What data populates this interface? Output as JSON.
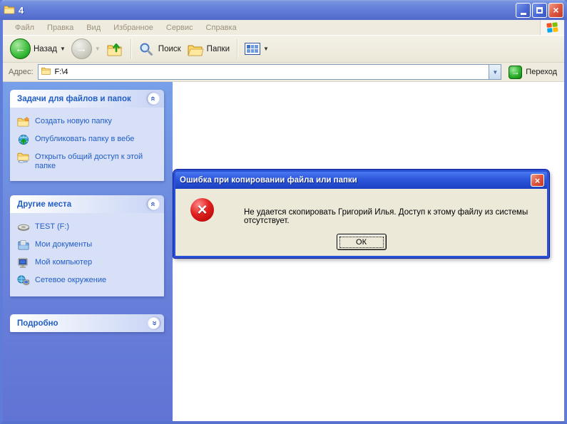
{
  "window": {
    "title": "4",
    "controls": {
      "minimize": "",
      "maximize": "",
      "close": "×"
    }
  },
  "menu": {
    "items": [
      "Файл",
      "Правка",
      "Вид",
      "Избранное",
      "Сервис",
      "Справка"
    ]
  },
  "toolbar": {
    "back_label": "Назад",
    "search_label": "Поиск",
    "folders_label": "Папки"
  },
  "address_bar": {
    "label": "Адрес:",
    "value": "F:\\4",
    "go_label": "Переход"
  },
  "sidebar": {
    "panels": [
      {
        "title": "Задачи для файлов и папок",
        "state": "expanded",
        "items": [
          {
            "icon": "new-folder-icon",
            "label": "Создать новую папку"
          },
          {
            "icon": "publish-web-icon",
            "label": "Опубликовать папку в вебе"
          },
          {
            "icon": "share-folder-icon",
            "label": "Открыть общий доступ к этой папке"
          }
        ]
      },
      {
        "title": "Другие места",
        "state": "expanded",
        "items": [
          {
            "icon": "disk-drive-icon",
            "label": "TEST (F:)"
          },
          {
            "icon": "my-documents-icon",
            "label": "Мои документы"
          },
          {
            "icon": "my-computer-icon",
            "label": "Мой компьютер"
          },
          {
            "icon": "network-icon",
            "label": "Сетевое окружение"
          }
        ]
      },
      {
        "title": "Подробно",
        "state": "collapsed",
        "items": []
      }
    ]
  },
  "dialog": {
    "title": "Ошибка при копировании файла или папки",
    "message": "Не удается скопировать Григорий Илья. Доступ к этому файлу из системы отсутствует.",
    "ok_label": "ОК",
    "close_glyph": "×"
  },
  "colors": {
    "titlebar_blue": "#6580D9",
    "dialog_border_blue": "#2A50D4",
    "taskpane_body": "#D7E0F7",
    "link_blue": "#215DC6",
    "error_red": "#C80000",
    "chrome_beige": "#EFEBDE"
  }
}
